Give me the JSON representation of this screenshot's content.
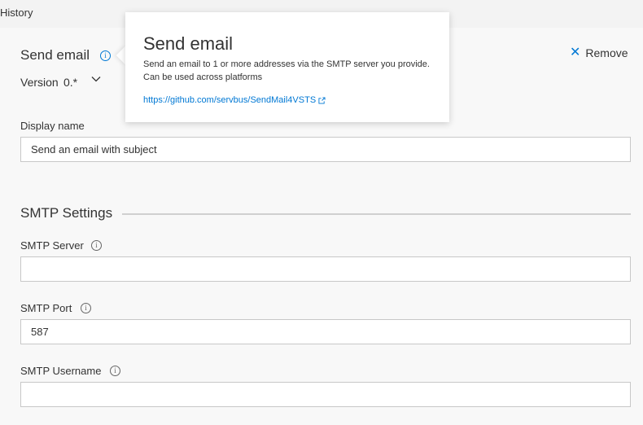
{
  "header": {
    "history_label": "History"
  },
  "task": {
    "title": "Send email",
    "remove_label": "Remove",
    "version_label": "Version",
    "version_value": "0.*"
  },
  "display_name": {
    "label": "Display name",
    "value": "Send an email with subject"
  },
  "smtp": {
    "section_title": "SMTP Settings",
    "server": {
      "label": "SMTP Server",
      "value": ""
    },
    "port": {
      "label": "SMTP Port",
      "value": "587"
    },
    "username": {
      "label": "SMTP Username",
      "value": ""
    }
  },
  "popup": {
    "title": "Send email",
    "description": "Send an email to 1 or more addresses via the SMTP server you provide. Can be used across platforms",
    "link": "https://github.com/servbus/SendMail4VSTS"
  },
  "icons": {
    "info": "info-icon",
    "remove": "close-icon",
    "version_dropdown": "chevron-down-icon",
    "external_link": "external-link-icon"
  },
  "colors": {
    "accent": "#0078d4"
  }
}
